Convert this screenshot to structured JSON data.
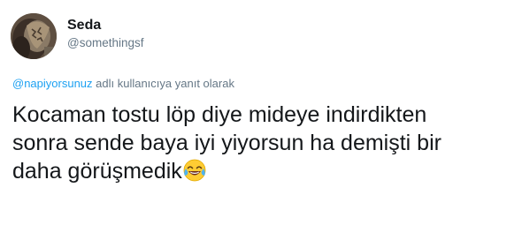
{
  "user": {
    "display_name": "Seda",
    "handle": "@somethingsf"
  },
  "reply": {
    "mention": "@napiyorsunuz",
    "suffix": " adlı kullanıcıya yanıt olarak"
  },
  "tweet": {
    "line1": "Kocaman tostu löp diye mideye indirdikten",
    "line2": "sonra sende baya iyi yiyorsun ha demişti bir",
    "line3": "daha görüşmedik",
    "emoji": "face-with-tears-of-joy-icon"
  },
  "colors": {
    "text": "#14171a",
    "secondary": "#657786",
    "link": "#1da1f2"
  }
}
